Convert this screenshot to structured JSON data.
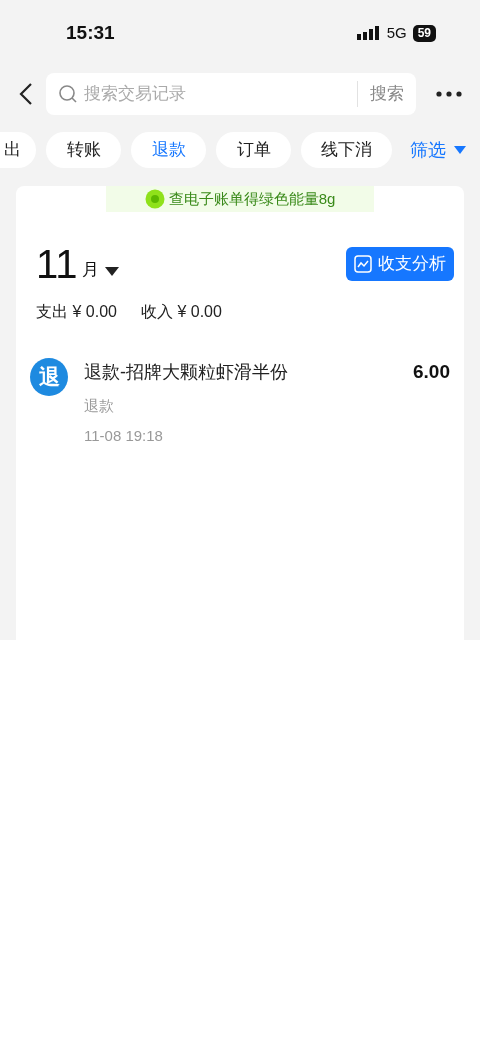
{
  "status_bar": {
    "time": "15:31",
    "network": "5G",
    "battery": "59"
  },
  "search": {
    "placeholder": "搜索交易记录",
    "button": "搜索"
  },
  "filters": [
    {
      "label": "出",
      "selected": false
    },
    {
      "label": "转账",
      "selected": false
    },
    {
      "label": "退款",
      "selected": true
    },
    {
      "label": "订单",
      "selected": false
    },
    {
      "label": "线下消",
      "selected": false
    }
  ],
  "filter_button": "筛选",
  "banner": "查电子账单得绿色能量8g",
  "month": {
    "number": "11",
    "unit": "月"
  },
  "analysis_button": "收支分析",
  "summary": [
    "支出 ¥ 0.00",
    "收入 ¥ 0.00"
  ],
  "transactions": [
    {
      "badge": "退",
      "title": "退款-招牌大颗粒虾滑半份",
      "amount": "6.00",
      "category": "退款",
      "time": "11-08 19:18"
    }
  ]
}
